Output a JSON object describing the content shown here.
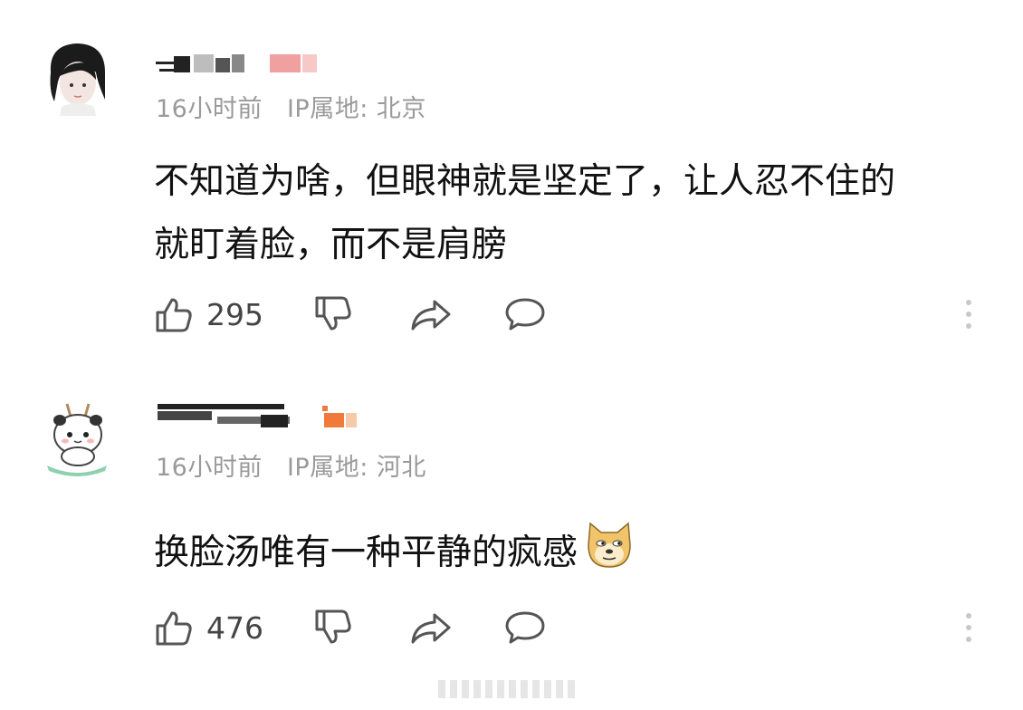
{
  "comments": [
    {
      "time": "16小时前",
      "ip": "IP属地: 北京",
      "text_line1": "不知道为啥，但眼神就是坚定了，让人忍不住的",
      "text_line2": "就盯着脸，而不是肩膀",
      "likes": "295"
    },
    {
      "time": "16小时前",
      "ip": "IP属地: 河北",
      "text_line1": "换脸汤唯有一种平静的疯感",
      "likes": "476"
    }
  ],
  "icons": [
    "thumbs-up-icon",
    "thumbs-down-icon",
    "share-icon",
    "comment-icon",
    "more-icon",
    "doge-emoji"
  ],
  "colors": {
    "meta": "#9a9a9a",
    "icon": "#555555",
    "redact_pink": "#f0a0a0",
    "redact_orange": "#f07a3a"
  }
}
